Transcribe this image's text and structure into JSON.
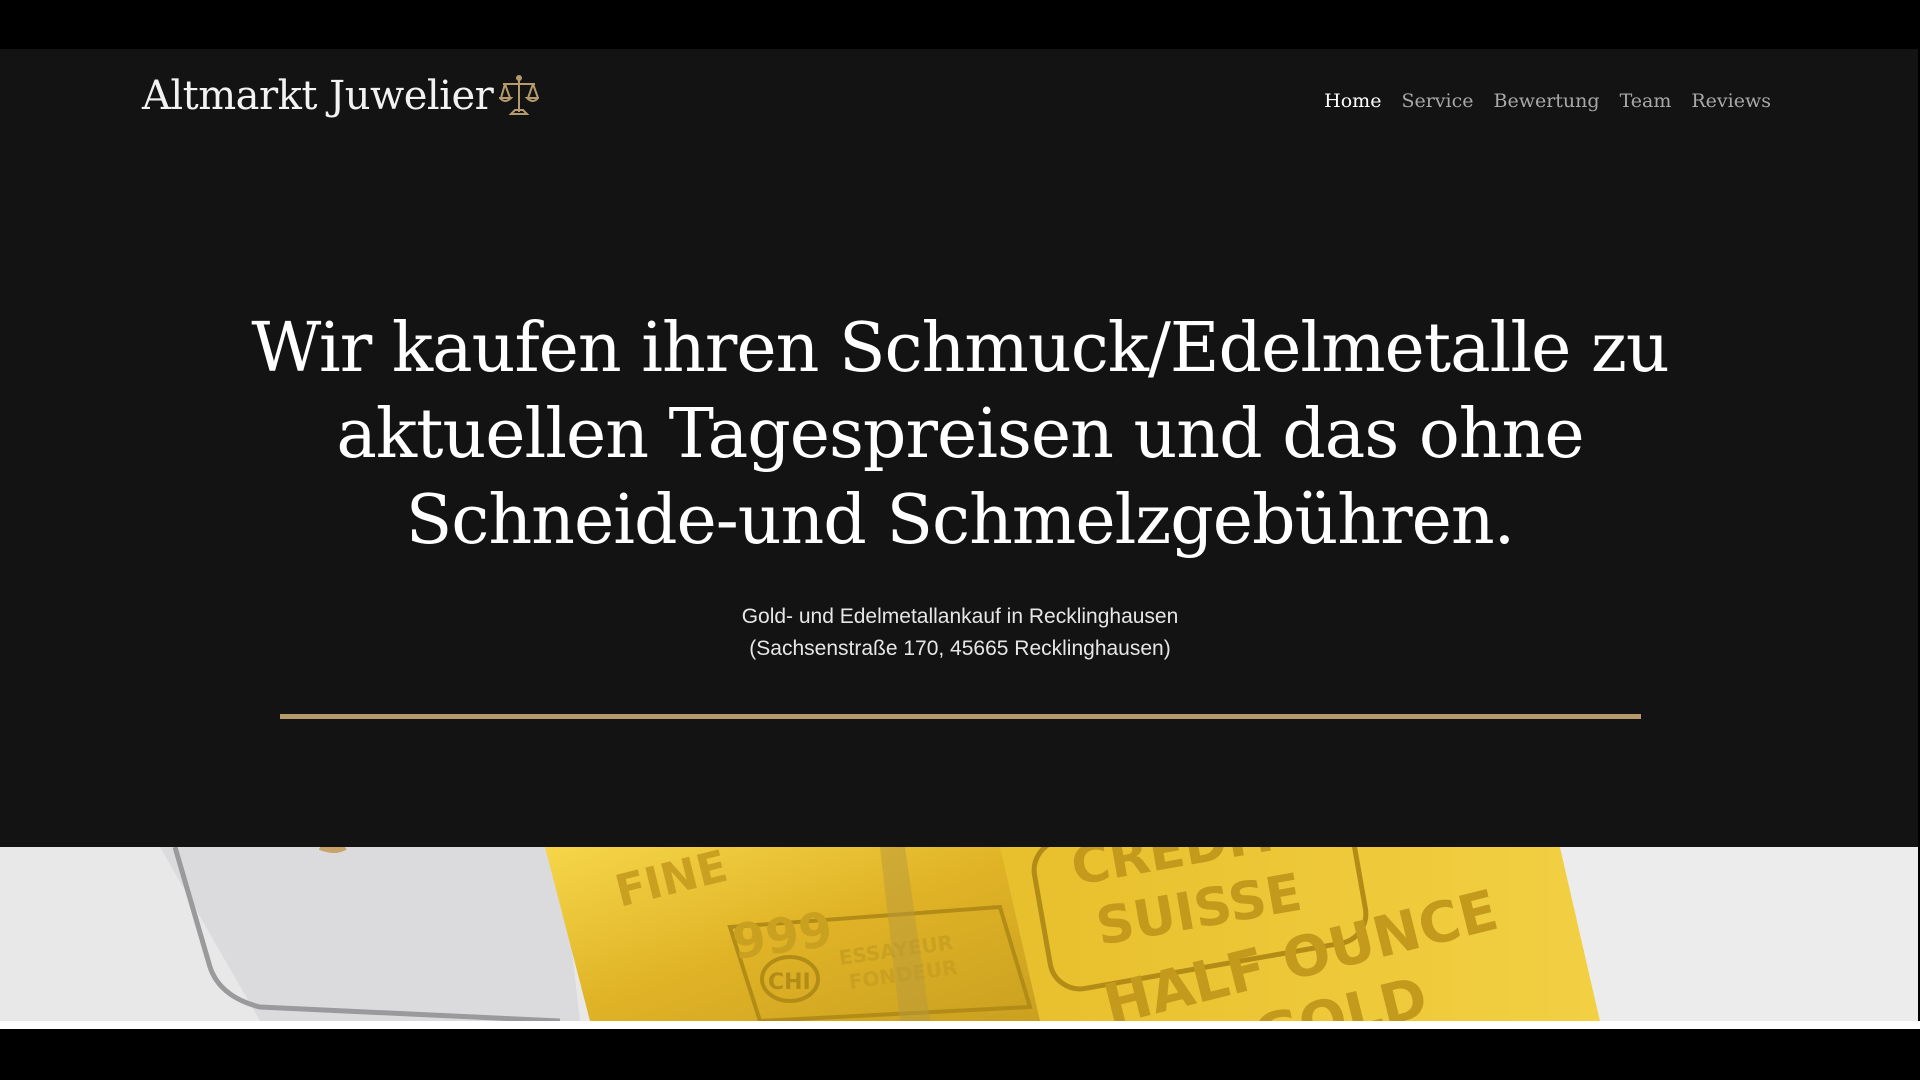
{
  "brand": {
    "name": "Altmarkt Juwelier",
    "icon": "scales-icon",
    "accent_color": "#b59b6b"
  },
  "nav": {
    "items": [
      {
        "label": "Home",
        "active": true
      },
      {
        "label": "Service",
        "active": false
      },
      {
        "label": "Bewertung",
        "active": false
      },
      {
        "label": "Team",
        "active": false
      },
      {
        "label": "Reviews",
        "active": false
      }
    ]
  },
  "hero": {
    "title_lines": [
      "Wir kaufen ihren Schmuck/Edelmetalle zu",
      "aktuellen Tagespreisen und das ohne",
      "Schneide-und Schmelzgebühren."
    ],
    "subtitle_lines": [
      "Gold- und Edelmetallankauf in Recklinghausen",
      "(Sachsenstraße 170, 45665 Recklinghausen)"
    ]
  },
  "image": {
    "bar_left_text": [
      "FINE",
      "999",
      "ESSAYEUR",
      "FONDEUR"
    ],
    "bar_left_logo": "CHI",
    "bar_right_text": [
      "CREDIT",
      "SUISSE",
      "HALF OUNCE",
      "GOLD"
    ]
  },
  "colors": {
    "page_background": "#131313",
    "text": "#ffffff",
    "nav_inactive": "#a8a8a8",
    "gold": "#e2b52a"
  }
}
